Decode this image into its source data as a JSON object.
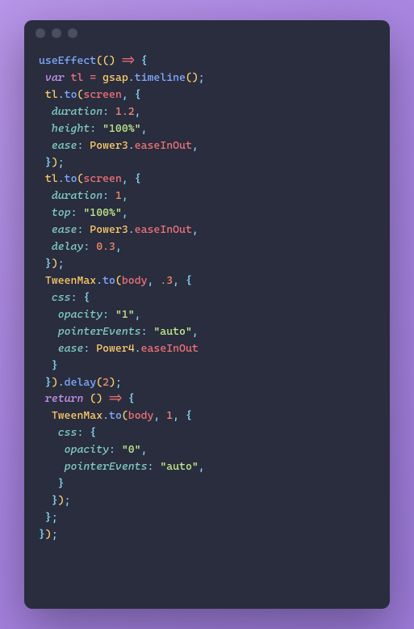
{
  "colors": {
    "bg_window": "#292d3e",
    "bg_gradient_start": "#b795e8",
    "bg_gradient_end": "#9b7ad8",
    "titlebar_dot": "#4a4e5e"
  },
  "code": {
    "lines": [
      [
        [
          "fn",
          "useEffect"
        ],
        [
          "paren",
          "(()"
        ],
        [
          "def",
          " => "
        ],
        [
          "punc",
          "{"
        ]
      ],
      [
        [
          "kw",
          " var "
        ],
        [
          "def",
          "tl"
        ],
        [
          "def",
          " = "
        ],
        [
          "id",
          "gsap"
        ],
        [
          "punc",
          "."
        ],
        [
          "fn",
          "timeline"
        ],
        [
          "paren",
          "()"
        ],
        [
          "punc",
          ";"
        ]
      ],
      [
        [
          "id",
          " tl"
        ],
        [
          "punc",
          "."
        ],
        [
          "fn",
          "to"
        ],
        [
          "paren",
          "("
        ],
        [
          "def",
          "screen"
        ],
        [
          "punc",
          ", {"
        ]
      ],
      [
        [
          "prop",
          "  duration"
        ],
        [
          "punc",
          ": "
        ],
        [
          "num",
          "1.2"
        ],
        [
          "punc",
          ","
        ]
      ],
      [
        [
          "prop",
          "  height"
        ],
        [
          "punc",
          ": "
        ],
        [
          "str",
          "\"100%\""
        ],
        [
          "punc",
          ","
        ]
      ],
      [
        [
          "prop",
          "  ease"
        ],
        [
          "punc",
          ": "
        ],
        [
          "id",
          "Power3"
        ],
        [
          "punc",
          "."
        ],
        [
          "def",
          "easeInOut"
        ],
        [
          "punc",
          ","
        ]
      ],
      [
        [
          "punc",
          " }"
        ],
        [
          "paren",
          ")"
        ],
        [
          "punc",
          ";"
        ]
      ],
      [
        [
          "id",
          " tl"
        ],
        [
          "punc",
          "."
        ],
        [
          "fn",
          "to"
        ],
        [
          "paren",
          "("
        ],
        [
          "def",
          "screen"
        ],
        [
          "punc",
          ", {"
        ]
      ],
      [
        [
          "prop",
          "  duration"
        ],
        [
          "punc",
          ": "
        ],
        [
          "num",
          "1"
        ],
        [
          "punc",
          ","
        ]
      ],
      [
        [
          "prop",
          "  top"
        ],
        [
          "punc",
          ": "
        ],
        [
          "str",
          "\"100%\""
        ],
        [
          "punc",
          ","
        ]
      ],
      [
        [
          "prop",
          "  ease"
        ],
        [
          "punc",
          ": "
        ],
        [
          "id",
          "Power3"
        ],
        [
          "punc",
          "."
        ],
        [
          "def",
          "easeInOut"
        ],
        [
          "punc",
          ","
        ]
      ],
      [
        [
          "prop",
          "  delay"
        ],
        [
          "punc",
          ": "
        ],
        [
          "num",
          "0.3"
        ],
        [
          "punc",
          ","
        ]
      ],
      [
        [
          "punc",
          " }"
        ],
        [
          "paren",
          ")"
        ],
        [
          "punc",
          ";"
        ]
      ],
      [
        [
          "id",
          " TweenMax"
        ],
        [
          "punc",
          "."
        ],
        [
          "fn",
          "to"
        ],
        [
          "paren",
          "("
        ],
        [
          "def",
          "body"
        ],
        [
          "punc",
          ", "
        ],
        [
          "num",
          ".3"
        ],
        [
          "punc",
          ", {"
        ]
      ],
      [
        [
          "prop",
          "  css"
        ],
        [
          "punc",
          ": {"
        ]
      ],
      [
        [
          "prop",
          "   opacity"
        ],
        [
          "punc",
          ": "
        ],
        [
          "str",
          "\"1\""
        ],
        [
          "punc",
          ","
        ]
      ],
      [
        [
          "prop",
          "   pointerEvents"
        ],
        [
          "punc",
          ": "
        ],
        [
          "str",
          "\"auto\""
        ],
        [
          "punc",
          ","
        ]
      ],
      [
        [
          "prop",
          "   ease"
        ],
        [
          "punc",
          ": "
        ],
        [
          "id",
          "Power4"
        ],
        [
          "punc",
          "."
        ],
        [
          "def",
          "easeInOut"
        ]
      ],
      [
        [
          "punc",
          "  }"
        ]
      ],
      [
        [
          "punc",
          " }"
        ],
        [
          "paren",
          ")"
        ],
        [
          "punc",
          "."
        ],
        [
          "fn",
          "delay"
        ],
        [
          "paren",
          "("
        ],
        [
          "num",
          "2"
        ],
        [
          "paren",
          ")"
        ],
        [
          "punc",
          ";"
        ]
      ],
      [
        [
          "kw",
          " return"
        ],
        [
          "def",
          " "
        ],
        [
          "paren",
          "()"
        ],
        [
          "def",
          " => "
        ],
        [
          "punc",
          "{"
        ]
      ],
      [
        [
          "id",
          "  TweenMax"
        ],
        [
          "punc",
          "."
        ],
        [
          "fn",
          "to"
        ],
        [
          "paren",
          "("
        ],
        [
          "def",
          "body"
        ],
        [
          "punc",
          ", "
        ],
        [
          "num",
          "1"
        ],
        [
          "punc",
          ", {"
        ]
      ],
      [
        [
          "prop",
          "   css"
        ],
        [
          "punc",
          ": {"
        ]
      ],
      [
        [
          "prop",
          "    opacity"
        ],
        [
          "punc",
          ": "
        ],
        [
          "str",
          "\"0\""
        ],
        [
          "punc",
          ","
        ]
      ],
      [
        [
          "prop",
          "    pointerEvents"
        ],
        [
          "punc",
          ": "
        ],
        [
          "str",
          "\"auto\""
        ],
        [
          "punc",
          ","
        ]
      ],
      [
        [
          "punc",
          "   }"
        ]
      ],
      [
        [
          "punc",
          "  }"
        ],
        [
          "paren",
          ")"
        ],
        [
          "punc",
          ";"
        ]
      ],
      [
        [
          "punc",
          " };"
        ]
      ],
      [
        [
          "punc",
          "}"
        ],
        [
          "paren",
          ")"
        ],
        [
          "punc",
          ";"
        ]
      ]
    ]
  }
}
